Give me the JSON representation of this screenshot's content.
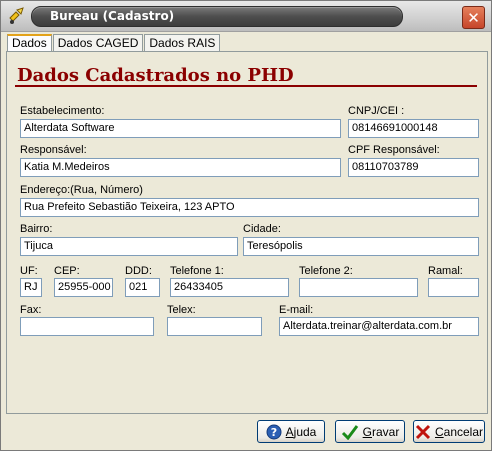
{
  "window": {
    "title": "Bureau (Cadastro)",
    "close_symbol": "✕"
  },
  "tabs": [
    {
      "label": "Dados"
    },
    {
      "label": "Dados CAGED"
    },
    {
      "label": "Dados RAIS"
    }
  ],
  "form": {
    "heading": "Dados Cadastrados no PHD",
    "estabelecimento": {
      "label": "Estabelecimento:",
      "value": "Alterdata Software"
    },
    "cnpj": {
      "label": "CNPJ/CEI :",
      "value": "08146691000148"
    },
    "responsavel": {
      "label": "Responsável:",
      "value": "Katia M.Medeiros"
    },
    "cpf_responsavel": {
      "label": "CPF Responsável:",
      "value": "08110703789"
    },
    "endereco": {
      "label": "Endereço:(Rua, Número)",
      "value": "Rua Prefeito Sebastião Teixeira, 123 APTO"
    },
    "bairro": {
      "label": "Bairro:",
      "value": "Tijuca"
    },
    "cidade": {
      "label": "Cidade:",
      "value": "Teresópolis"
    },
    "uf": {
      "label": "UF:",
      "value": "RJ"
    },
    "cep": {
      "label": "CEP:",
      "value": "25955-000"
    },
    "ddd": {
      "label": "DDD:",
      "value": "021"
    },
    "telefone1": {
      "label": "Telefone 1:",
      "value": "26433405"
    },
    "telefone2": {
      "label": "Telefone 2:",
      "value": ""
    },
    "ramal": {
      "label": "Ramal:",
      "value": ""
    },
    "fax": {
      "label": "Fax:",
      "value": ""
    },
    "telex": {
      "label": "Telex:",
      "value": ""
    },
    "email": {
      "label": "E-mail:",
      "value": "Alterdata.treinar@alterdata.com.br"
    }
  },
  "buttons": {
    "ajuda": {
      "first": "A",
      "rest": "juda",
      "icon": "help-icon"
    },
    "gravar": {
      "first": "G",
      "rest": "ravar",
      "icon": "checkmark-icon"
    },
    "cancelar": {
      "first": "C",
      "rest": "ancelar",
      "icon": "x-icon"
    }
  },
  "colors": {
    "heading": "#8b0000",
    "close_button": "#c6452a",
    "title_bar": "#4e4e4e"
  }
}
